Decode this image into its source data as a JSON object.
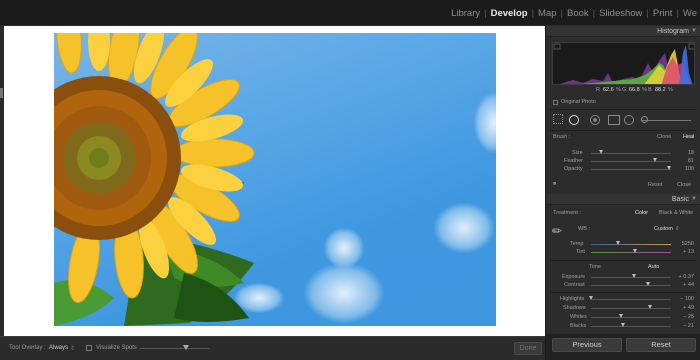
{
  "modules": {
    "items": [
      {
        "label": "Library",
        "active": false
      },
      {
        "label": "Develop",
        "active": true
      },
      {
        "label": "Map",
        "active": false
      },
      {
        "label": "Book",
        "active": false
      },
      {
        "label": "Slideshow",
        "active": false
      },
      {
        "label": "Print",
        "active": false
      },
      {
        "label": "We",
        "active": false
      }
    ]
  },
  "toolbar": {
    "tool_overlay_label": "Tool Overlay :",
    "tool_overlay_value": "Always",
    "visualize_spots_label": "Visualize Spots",
    "done_label": "Done"
  },
  "histogram": {
    "title": "Histogram",
    "r_label": "R",
    "r_value": "62.6",
    "g_label": "G",
    "g_value": "66.8",
    "b_label": "B",
    "b_value": "88.2",
    "percent": "%",
    "original_photo": "Original Photo"
  },
  "brush": {
    "label": "Brush :",
    "clone": "Clone",
    "heal": "Heal",
    "size_label": "Size",
    "size_value": "18",
    "feather_label": "Feather",
    "feather_value": "81",
    "opacity_label": "Opacity",
    "opacity_value": "100",
    "reset": "Reset",
    "close": "Close"
  },
  "basic": {
    "title": "Basic",
    "treatment_label": "Treatment :",
    "color": "Color",
    "bw": "Black & White",
    "wb_label": "WB :",
    "wb_value": "Custom",
    "temp_label": "Temp",
    "temp_value": "5250",
    "tint_label": "Tint",
    "tint_value": "+ 13",
    "tone_label": "Tone",
    "auto_label": "Auto",
    "exposure_label": "Exposure",
    "exposure_value": "+ 0.37",
    "contrast_label": "Contrast",
    "contrast_value": "+ 44",
    "highlights_label": "Highlights",
    "highlights_value": "− 100",
    "shadows_label": "Shadows",
    "shadows_value": "+ 49",
    "whites_label": "Whites",
    "whites_value": "− 25",
    "blacks_label": "Blacks",
    "blacks_value": "− 21"
  },
  "nav": {
    "previous": "Previous",
    "reset": "Reset"
  },
  "colors": {
    "accent_arrow": "#d6156a",
    "sky": "#4a9de2",
    "panel_bg": "#2c2c2c"
  }
}
